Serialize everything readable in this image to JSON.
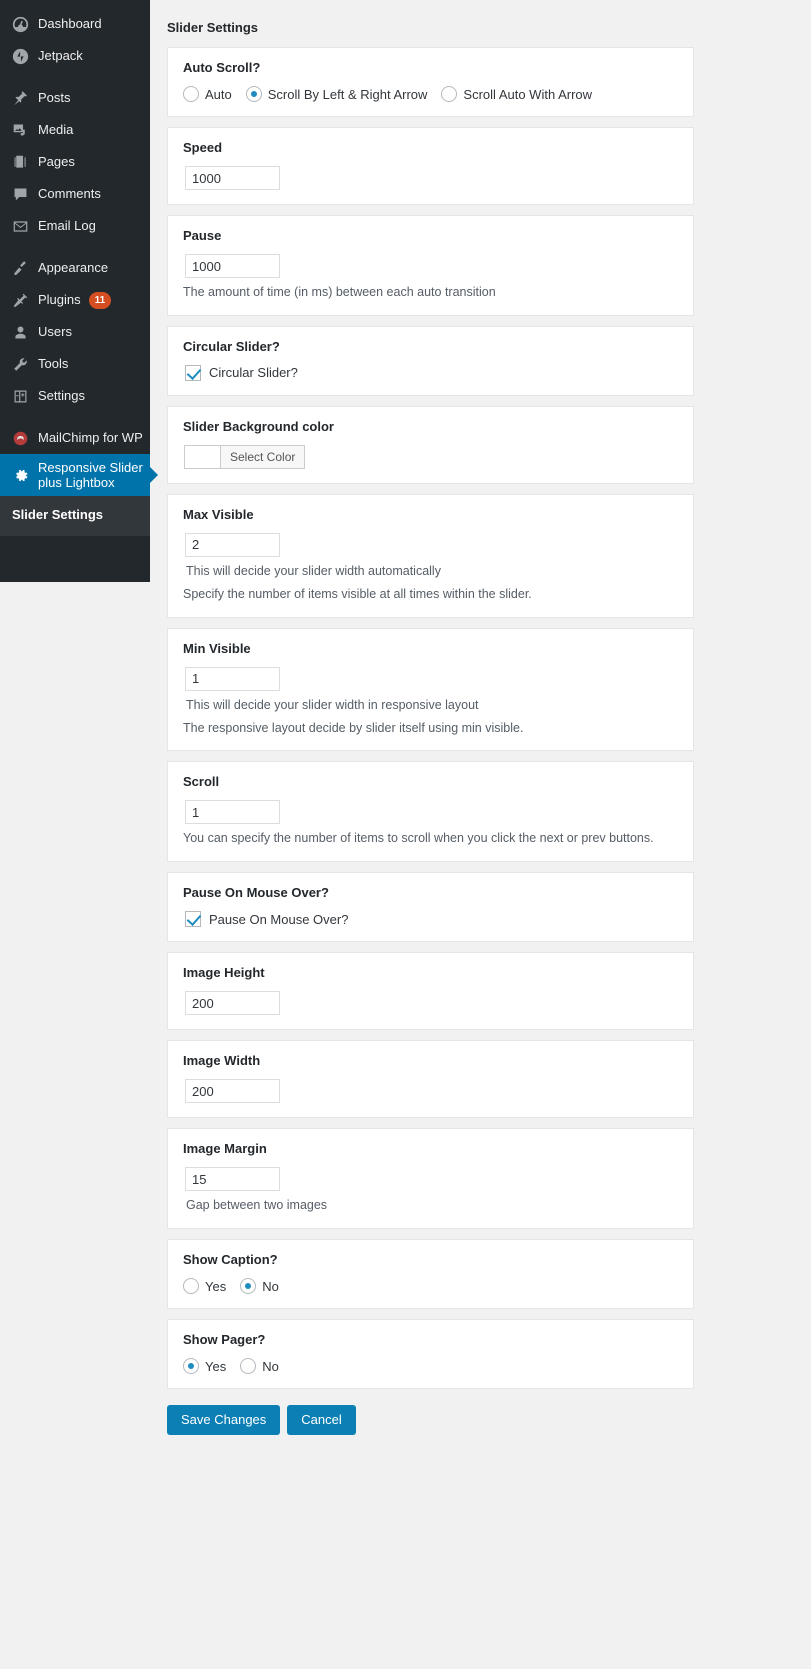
{
  "sidebar": {
    "items": [
      {
        "label": "Dashboard",
        "icon": "dashboard-icon"
      },
      {
        "label": "Jetpack",
        "icon": "jetpack-icon"
      },
      {
        "label": "Posts",
        "icon": "pin-icon"
      },
      {
        "label": "Media",
        "icon": "media-icon"
      },
      {
        "label": "Pages",
        "icon": "pages-icon"
      },
      {
        "label": "Comments",
        "icon": "comments-icon"
      },
      {
        "label": "Email Log",
        "icon": "email-icon"
      },
      {
        "label": "Appearance",
        "icon": "appearance-icon"
      },
      {
        "label": "Plugins",
        "icon": "plugins-icon",
        "badge": "11"
      },
      {
        "label": "Users",
        "icon": "users-icon"
      },
      {
        "label": "Tools",
        "icon": "tools-icon"
      },
      {
        "label": "Settings",
        "icon": "settings-icon"
      },
      {
        "label": "MailChimp for WP",
        "icon": "mailchimp-icon"
      }
    ],
    "active_item": {
      "label": "Responsive Slider plus Lightbox",
      "icon": "gear-icon"
    },
    "submenu": [
      {
        "label": "Slider Settings"
      }
    ]
  },
  "main": {
    "page_title": "Slider Settings",
    "sections": {
      "auto_scroll": {
        "label": "Auto Scroll?",
        "options": [
          {
            "label": "Auto",
            "selected": false
          },
          {
            "label": "Scroll By Left & Right Arrow",
            "selected": true
          },
          {
            "label": "Scroll Auto With Arrow",
            "selected": false
          }
        ]
      },
      "speed": {
        "label": "Speed",
        "value": "1000"
      },
      "pause": {
        "label": "Pause",
        "value": "1000",
        "desc": "The amount of time (in ms) between each auto transition"
      },
      "circular_slider": {
        "label": "Circular Slider?",
        "checkbox_label": "Circular Slider?",
        "checked": true
      },
      "slider_background_color": {
        "label": "Slider Background color",
        "button_label": "Select Color",
        "swatch_color": "#ffffff"
      },
      "max_visible": {
        "label": "Max Visible",
        "value": "2",
        "desc1": "This will decide your slider width automatically",
        "desc2": "Specify the number of items visible at all times within the slider."
      },
      "min_visible": {
        "label": "Min Visible",
        "value": "1",
        "desc1": "This will decide your slider width in responsive layout",
        "desc2": "The responsive layout decide by slider itself using min visible."
      },
      "scroll": {
        "label": "Scroll",
        "value": "1",
        "desc": "You can specify the number of items to scroll when you click the next or prev buttons."
      },
      "pause_on_mouse_over": {
        "label": "Pause On Mouse Over?",
        "checkbox_label": "Pause On Mouse Over?",
        "checked": true
      },
      "image_height": {
        "label": "Image Height",
        "value": "200"
      },
      "image_width": {
        "label": "Image Width",
        "value": "200"
      },
      "image_margin": {
        "label": "Image Margin",
        "value": "15",
        "desc": "Gap between two images"
      },
      "show_caption": {
        "label": "Show Caption?",
        "options": [
          {
            "label": "Yes",
            "selected": false
          },
          {
            "label": "No",
            "selected": true
          }
        ]
      },
      "show_pager": {
        "label": "Show Pager?",
        "options": [
          {
            "label": "Yes",
            "selected": true
          },
          {
            "label": "No",
            "selected": false
          }
        ]
      }
    },
    "buttons": {
      "save": "Save Changes",
      "cancel": "Cancel"
    }
  },
  "colors": {
    "accent": "#0073aa",
    "button": "#0c7fb5",
    "sidebar_bg": "#23282d",
    "submenu_bg": "#32373c",
    "badge": "#d54e21",
    "control_blue": "#1e8cbe"
  }
}
